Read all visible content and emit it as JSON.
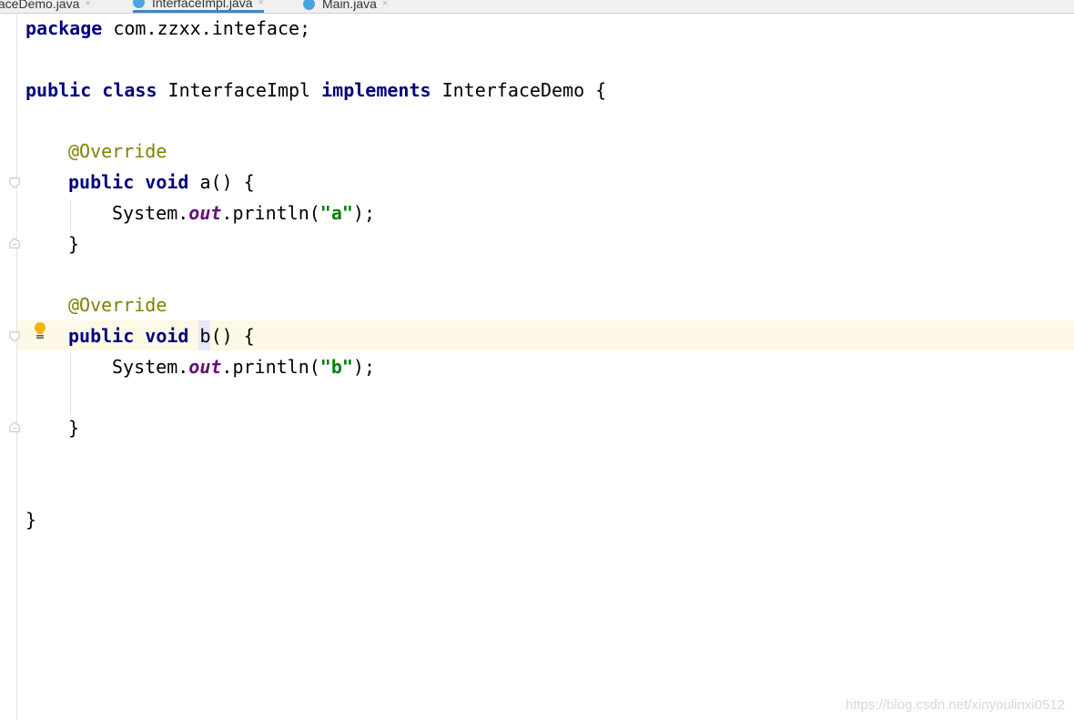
{
  "tabs": [
    {
      "label": "faceDemo.java",
      "close": "×"
    },
    {
      "label": "InterfaceImpl.java",
      "close": "×"
    },
    {
      "label": "Main.java",
      "close": "×"
    }
  ],
  "code": {
    "pkg_kw": "package",
    "pkg_name": " com.zzxx.inteface;",
    "l3_public": "public",
    "l3_class": "class",
    "l3_name": " InterfaceImpl ",
    "l3_impl": "implements",
    "l3_iface": " InterfaceDemo {",
    "override": "@Override",
    "public": "public",
    "void": "void",
    "a_sig": " a() {",
    "b_name": "b",
    "b_rest": "() {",
    "sys": "System.",
    "out": "out",
    "println": ".println(",
    "str_a": "\"a\"",
    "str_b": "\"b\"",
    "tail": ");",
    "close_brace": "}"
  },
  "watermark": "https://blog.csdn.net/xinyoulinxi0512",
  "colors": {
    "keyword": "#000080",
    "annotation": "#808000",
    "field": "#660e7a",
    "string": "#008000",
    "current_line": "#fdf9e6"
  },
  "icons": [
    "lightbulb-icon",
    "fold-marker-icon",
    "java-class-icon",
    "close-tab-icon"
  ]
}
